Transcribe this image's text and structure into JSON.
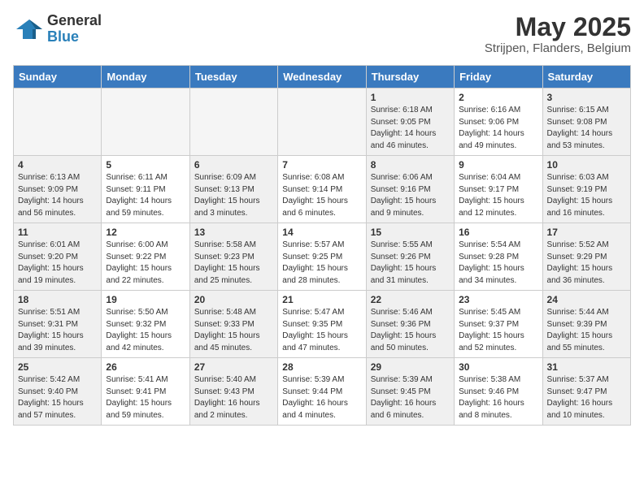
{
  "header": {
    "logo_general": "General",
    "logo_blue": "Blue",
    "title": "May 2025",
    "location": "Strijpen, Flanders, Belgium"
  },
  "days_of_week": [
    "Sunday",
    "Monday",
    "Tuesday",
    "Wednesday",
    "Thursday",
    "Friday",
    "Saturday"
  ],
  "weeks": [
    [
      {
        "day": "",
        "content": ""
      },
      {
        "day": "",
        "content": ""
      },
      {
        "day": "",
        "content": ""
      },
      {
        "day": "",
        "content": ""
      },
      {
        "day": "1",
        "content": "Sunrise: 6:18 AM\nSunset: 9:05 PM\nDaylight: 14 hours\nand 46 minutes."
      },
      {
        "day": "2",
        "content": "Sunrise: 6:16 AM\nSunset: 9:06 PM\nDaylight: 14 hours\nand 49 minutes."
      },
      {
        "day": "3",
        "content": "Sunrise: 6:15 AM\nSunset: 9:08 PM\nDaylight: 14 hours\nand 53 minutes."
      }
    ],
    [
      {
        "day": "4",
        "content": "Sunrise: 6:13 AM\nSunset: 9:09 PM\nDaylight: 14 hours\nand 56 minutes."
      },
      {
        "day": "5",
        "content": "Sunrise: 6:11 AM\nSunset: 9:11 PM\nDaylight: 14 hours\nand 59 minutes."
      },
      {
        "day": "6",
        "content": "Sunrise: 6:09 AM\nSunset: 9:13 PM\nDaylight: 15 hours\nand 3 minutes."
      },
      {
        "day": "7",
        "content": "Sunrise: 6:08 AM\nSunset: 9:14 PM\nDaylight: 15 hours\nand 6 minutes."
      },
      {
        "day": "8",
        "content": "Sunrise: 6:06 AM\nSunset: 9:16 PM\nDaylight: 15 hours\nand 9 minutes."
      },
      {
        "day": "9",
        "content": "Sunrise: 6:04 AM\nSunset: 9:17 PM\nDaylight: 15 hours\nand 12 minutes."
      },
      {
        "day": "10",
        "content": "Sunrise: 6:03 AM\nSunset: 9:19 PM\nDaylight: 15 hours\nand 16 minutes."
      }
    ],
    [
      {
        "day": "11",
        "content": "Sunrise: 6:01 AM\nSunset: 9:20 PM\nDaylight: 15 hours\nand 19 minutes."
      },
      {
        "day": "12",
        "content": "Sunrise: 6:00 AM\nSunset: 9:22 PM\nDaylight: 15 hours\nand 22 minutes."
      },
      {
        "day": "13",
        "content": "Sunrise: 5:58 AM\nSunset: 9:23 PM\nDaylight: 15 hours\nand 25 minutes."
      },
      {
        "day": "14",
        "content": "Sunrise: 5:57 AM\nSunset: 9:25 PM\nDaylight: 15 hours\nand 28 minutes."
      },
      {
        "day": "15",
        "content": "Sunrise: 5:55 AM\nSunset: 9:26 PM\nDaylight: 15 hours\nand 31 minutes."
      },
      {
        "day": "16",
        "content": "Sunrise: 5:54 AM\nSunset: 9:28 PM\nDaylight: 15 hours\nand 34 minutes."
      },
      {
        "day": "17",
        "content": "Sunrise: 5:52 AM\nSunset: 9:29 PM\nDaylight: 15 hours\nand 36 minutes."
      }
    ],
    [
      {
        "day": "18",
        "content": "Sunrise: 5:51 AM\nSunset: 9:31 PM\nDaylight: 15 hours\nand 39 minutes."
      },
      {
        "day": "19",
        "content": "Sunrise: 5:50 AM\nSunset: 9:32 PM\nDaylight: 15 hours\nand 42 minutes."
      },
      {
        "day": "20",
        "content": "Sunrise: 5:48 AM\nSunset: 9:33 PM\nDaylight: 15 hours\nand 45 minutes."
      },
      {
        "day": "21",
        "content": "Sunrise: 5:47 AM\nSunset: 9:35 PM\nDaylight: 15 hours\nand 47 minutes."
      },
      {
        "day": "22",
        "content": "Sunrise: 5:46 AM\nSunset: 9:36 PM\nDaylight: 15 hours\nand 50 minutes."
      },
      {
        "day": "23",
        "content": "Sunrise: 5:45 AM\nSunset: 9:37 PM\nDaylight: 15 hours\nand 52 minutes."
      },
      {
        "day": "24",
        "content": "Sunrise: 5:44 AM\nSunset: 9:39 PM\nDaylight: 15 hours\nand 55 minutes."
      }
    ],
    [
      {
        "day": "25",
        "content": "Sunrise: 5:42 AM\nSunset: 9:40 PM\nDaylight: 15 hours\nand 57 minutes."
      },
      {
        "day": "26",
        "content": "Sunrise: 5:41 AM\nSunset: 9:41 PM\nDaylight: 15 hours\nand 59 minutes."
      },
      {
        "day": "27",
        "content": "Sunrise: 5:40 AM\nSunset: 9:43 PM\nDaylight: 16 hours\nand 2 minutes."
      },
      {
        "day": "28",
        "content": "Sunrise: 5:39 AM\nSunset: 9:44 PM\nDaylight: 16 hours\nand 4 minutes."
      },
      {
        "day": "29",
        "content": "Sunrise: 5:39 AM\nSunset: 9:45 PM\nDaylight: 16 hours\nand 6 minutes."
      },
      {
        "day": "30",
        "content": "Sunrise: 5:38 AM\nSunset: 9:46 PM\nDaylight: 16 hours\nand 8 minutes."
      },
      {
        "day": "31",
        "content": "Sunrise: 5:37 AM\nSunset: 9:47 PM\nDaylight: 16 hours\nand 10 minutes."
      }
    ]
  ]
}
